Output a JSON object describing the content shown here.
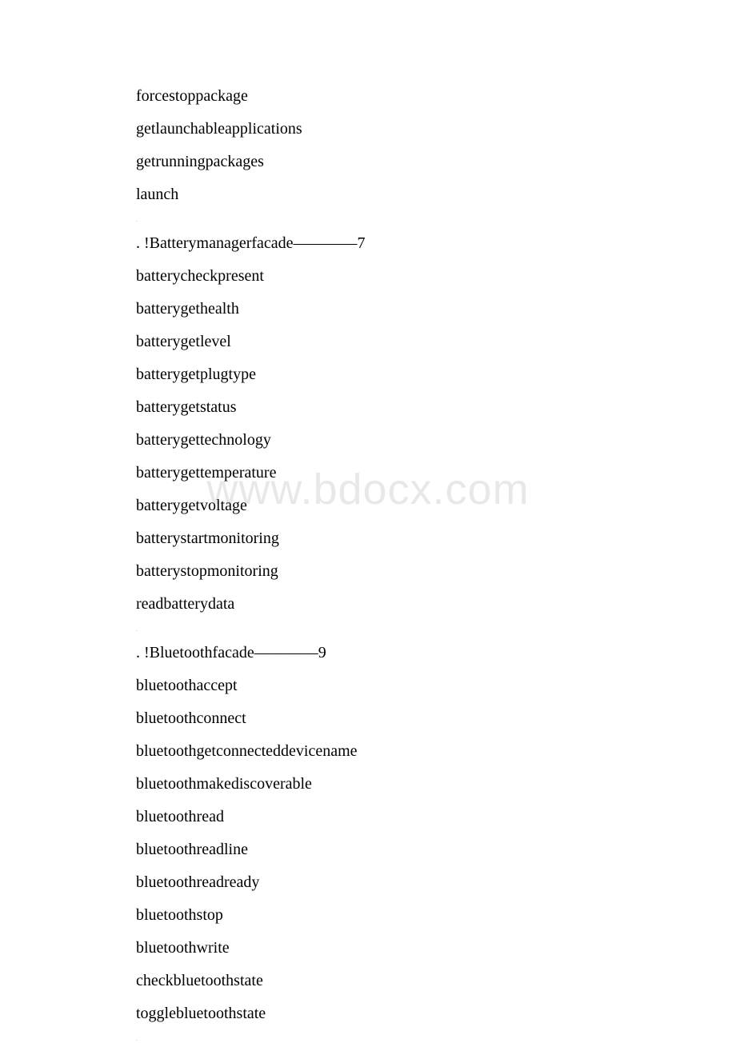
{
  "watermark": "www.bdocx.com",
  "sections": [
    {
      "pre_lines": [
        "forcestoppackage",
        "getlaunchableapplications",
        "getrunningpackages",
        "launch"
      ],
      "header": ". !Batterymanagerfacade————7",
      "items": [
        "batterycheckpresent",
        "batterygethealth",
        "batterygetlevel",
        "batterygetplugtype",
        "batterygetstatus",
        "batterygettechnology",
        "batterygettemperature",
        "batterygetvoltage",
        "batterystartmonitoring",
        "batterystopmonitoring",
        "readbatterydata"
      ]
    },
    {
      "header": ". !Bluetoothfacade————9",
      "items": [
        "bluetoothaccept",
        "bluetoothconnect",
        "bluetoothgetconnecteddevicename",
        "bluetoothmakediscoverable",
        "bluetoothread",
        "bluetoothreadline",
        "bluetoothreadready",
        "bluetoothstop",
        "bluetoothwrite",
        "checkbluetoothstate",
        "togglebluetoothstate"
      ]
    }
  ]
}
